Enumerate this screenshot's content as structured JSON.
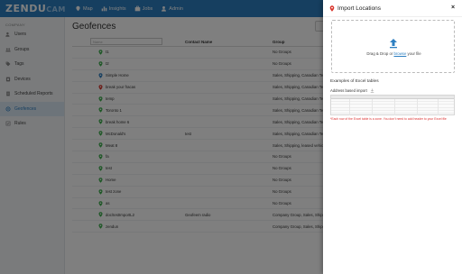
{
  "app": {
    "logo_main": "ZENDU",
    "logo_sub": "CAM"
  },
  "nav": [
    {
      "label": "Map",
      "icon": "map-pin-icon"
    },
    {
      "label": "Insights",
      "icon": "chart-icon"
    },
    {
      "label": "Jobs",
      "icon": "briefcase-icon"
    },
    {
      "label": "Admin",
      "icon": "user-icon"
    }
  ],
  "sidebar": {
    "header": "COMPANY",
    "items": [
      {
        "label": "Users",
        "icon": "users-icon",
        "active": false
      },
      {
        "label": "Groups",
        "icon": "groups-icon",
        "active": false
      },
      {
        "label": "Tags",
        "icon": "tag-icon",
        "active": false
      },
      {
        "label": "Devices",
        "icon": "device-icon",
        "active": false
      },
      {
        "label": "Scheduled Reports",
        "icon": "report-icon",
        "active": false
      },
      {
        "label": "Geofences",
        "icon": "geofence-icon",
        "active": true
      },
      {
        "label": "Rules",
        "icon": "rules-icon",
        "active": false
      }
    ]
  },
  "main": {
    "title": "Geofences",
    "filter_placeholder": "Name",
    "columns": {
      "contact": "Contact Name",
      "group": "Group"
    },
    "rows": [
      {
        "name": "t1",
        "contact": "",
        "group": "No Groups",
        "pin": "green"
      },
      {
        "name": "t2",
        "contact": "",
        "group": "No Groups",
        "pin": "green"
      },
      {
        "name": "Simple Home",
        "contact": "",
        "group": "Sales, Shipping, Canadian Tea",
        "pin": "blue"
      },
      {
        "name": "break your fracas",
        "contact": "",
        "group": "Sales, Shipping, Canadian Tea",
        "pin": "red"
      },
      {
        "name": "temp",
        "contact": "",
        "group": "Sales, Shipping, Canadian Tea",
        "pin": "green"
      },
      {
        "name": "Toronto 1",
        "contact": "",
        "group": "Sales, Shipping, Canadian Tea",
        "pin": "green"
      },
      {
        "name": "break home 6",
        "contact": "",
        "group": "Sales, Shipping, Canadian Tea",
        "pin": "green"
      },
      {
        "name": "McDonald's",
        "contact": "test",
        "group": "Sales, Shipping, Canadian Tea",
        "pin": "green"
      },
      {
        "name": "Meat 8",
        "contact": "",
        "group": "Sales, Shipping, leased vehicl",
        "pin": "green"
      },
      {
        "name": "fa",
        "contact": "",
        "group": "No Groups",
        "pin": "green"
      },
      {
        "name": "test",
        "contact": "",
        "group": "No Groups",
        "pin": "green"
      },
      {
        "name": "Home",
        "contact": "",
        "group": "No Groups",
        "pin": "green"
      },
      {
        "name": "test zone",
        "contact": "",
        "group": "No Groups",
        "pin": "green"
      },
      {
        "name": "as",
        "contact": "",
        "group": "No Groups",
        "pin": "green"
      },
      {
        "name": "doc/testImportL2",
        "contact": "Geofeem radio",
        "group": "Company Group, Sales, Shipping",
        "pin": "green"
      },
      {
        "name": "zendun",
        "contact": "",
        "group": "Company Group, Sales, Shipping",
        "pin": "green"
      }
    ]
  },
  "drawer": {
    "title": "Import Locations",
    "close": "×",
    "drop_prefix": "Drag & Drop or ",
    "drop_link": "browse",
    "drop_suffix": " your file",
    "examples_title": "Examples of Excel tables",
    "examples_sub": "Address based import",
    "note": "*Each row of the Excel table is a zone. You don't need to add header to your Excel file"
  },
  "colors": {
    "accent": "#2d7fc1",
    "pin_green": "#3cae4c",
    "pin_blue": "#2d7fc1",
    "pin_red": "#d9342b"
  }
}
